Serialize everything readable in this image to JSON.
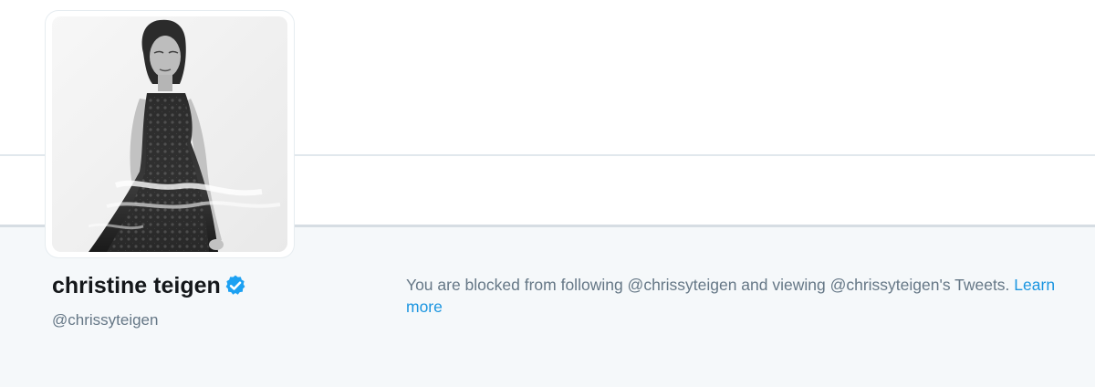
{
  "profile": {
    "name": "christine teigen",
    "handle": "@chrissyteigen",
    "verified": true,
    "verified_icon": "verified-badge-icon",
    "avatar_alt": "christine teigen profile photo"
  },
  "blocked_notice": {
    "message": "You are blocked from following @chrissyteigen and viewing @chrissyteigen's Tweets.",
    "link_label": "Learn more"
  },
  "colors": {
    "background": "#f5f8fa",
    "name_text": "#14171a",
    "secondary_text": "#657786",
    "link": "#1b95e0",
    "verified_badge": "#1da1f2"
  }
}
